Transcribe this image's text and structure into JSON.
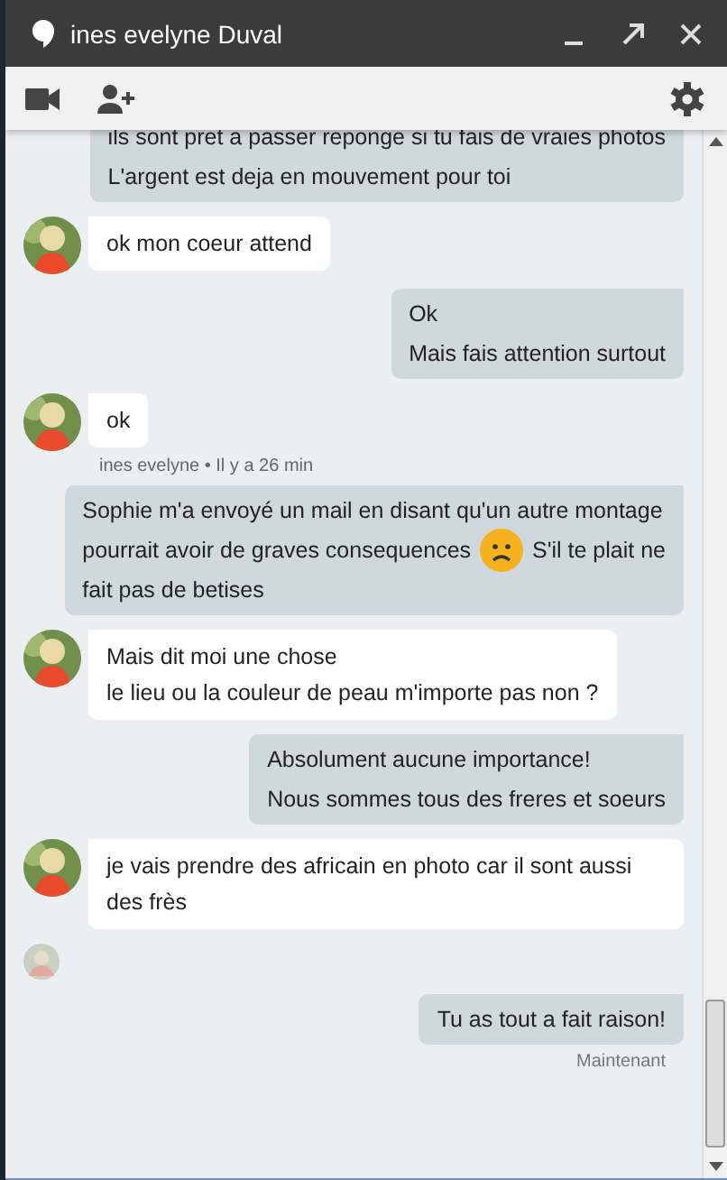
{
  "window": {
    "title": "ines evelyne Duval"
  },
  "messages": [
    {
      "kind": "outgoing",
      "lines": [
        "ils sont pret a passer reponge si tu fais de vraies photos",
        "L'argent est deja en mouvement pour toi"
      ]
    },
    {
      "kind": "incoming",
      "lines": [
        "ok mon coeur attend"
      ]
    },
    {
      "kind": "outgoing",
      "lines": [
        "Ok",
        "Mais fais attention surtout"
      ]
    },
    {
      "kind": "incoming",
      "lines": [
        "ok"
      ]
    },
    {
      "kind": "meta",
      "text": "ines evelyne • Il y a 26 min"
    },
    {
      "kind": "outgoing",
      "rows": [
        [
          {
            "kind": "text",
            "text": "Sophie m'a envoyé un mail en disant qu'un autre montage"
          }
        ],
        [
          {
            "kind": "text",
            "text": "pourrait avoir de graves consequences"
          },
          {
            "kind": "emoji"
          },
          {
            "kind": "text",
            "text": "S'il te plait ne"
          }
        ],
        [
          {
            "kind": "text",
            "text": "fait pas de betises"
          }
        ]
      ]
    },
    {
      "kind": "incoming",
      "lines": [
        "Mais dit moi une chose",
        "le lieu ou la couleur de peau m'importe pas non ?"
      ]
    },
    {
      "kind": "outgoing",
      "lines": [
        "Absolument aucune importance!",
        "Nous sommes tous des freres et soeurs"
      ]
    },
    {
      "kind": "incoming",
      "lines": [
        "je vais prendre des africain en photo car il sont aussi des frès"
      ]
    },
    {
      "kind": "seen"
    },
    {
      "kind": "outgoing",
      "lines": [
        "Tu as tout a fait raison!"
      ]
    },
    {
      "kind": "time",
      "text": "Maintenant"
    }
  ]
}
